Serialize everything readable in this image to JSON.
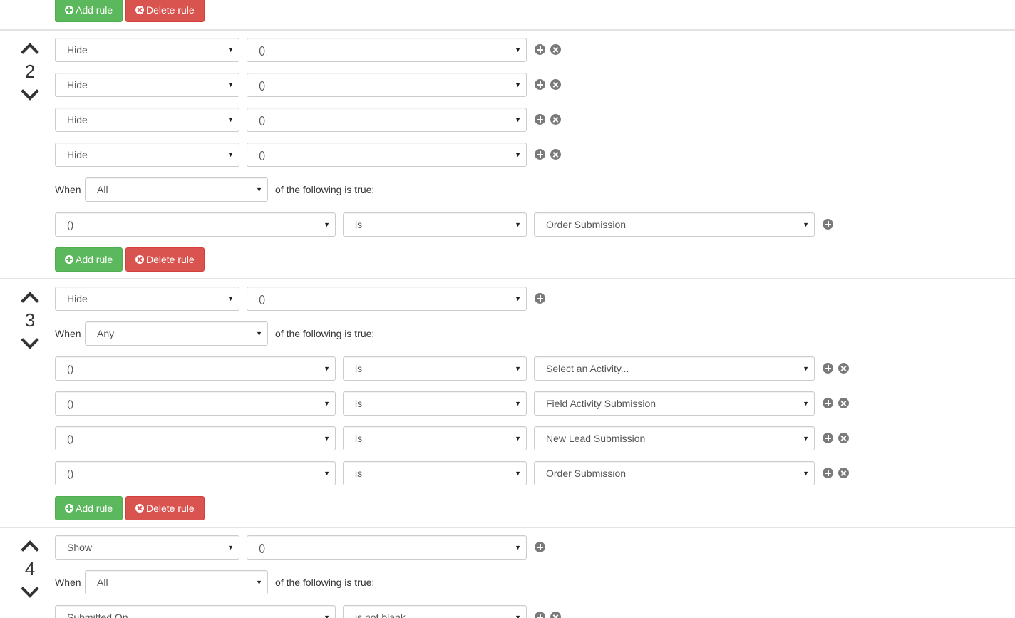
{
  "buttons": {
    "add_rule": "Add rule",
    "delete_rule": "Delete rule"
  },
  "labels": {
    "when": "When",
    "of_following": "of the following is true:"
  },
  "rules": [
    {
      "number": "2",
      "actions": [
        {
          "action": "Hide",
          "target": "()"
        },
        {
          "action": "Hide",
          "target": "()"
        },
        {
          "action": "Hide",
          "target": "()"
        },
        {
          "action": "Hide",
          "target": "()"
        }
      ],
      "match": "All",
      "conditions": [
        {
          "field": "()",
          "operator": "is",
          "value": "Order Submission"
        }
      ]
    },
    {
      "number": "3",
      "actions": [
        {
          "action": "Hide",
          "target": "()"
        }
      ],
      "match": "Any",
      "conditions": [
        {
          "field": "()",
          "operator": "is",
          "value": "Select an Activity..."
        },
        {
          "field": "()",
          "operator": "is",
          "value": "Field Activity Submission"
        },
        {
          "field": "()",
          "operator": "is",
          "value": "New Lead Submission"
        },
        {
          "field": "()",
          "operator": "is",
          "value": "Order Submission"
        }
      ]
    },
    {
      "number": "4",
      "actions": [
        {
          "action": "Show",
          "target": "()"
        }
      ],
      "match": "All",
      "conditions": [
        {
          "field": "Submitted On",
          "operator": "is not blank",
          "value": ""
        }
      ]
    }
  ],
  "icons": {
    "caret": "caret-down-icon",
    "add": "plus-circle-icon",
    "remove": "times-circle-icon",
    "up": "chevron-up-icon",
    "down": "chevron-down-icon"
  },
  "colors": {
    "add_button": "#5cb85c",
    "delete_button": "#d9534f",
    "icon_gray": "#7a7a7a"
  }
}
